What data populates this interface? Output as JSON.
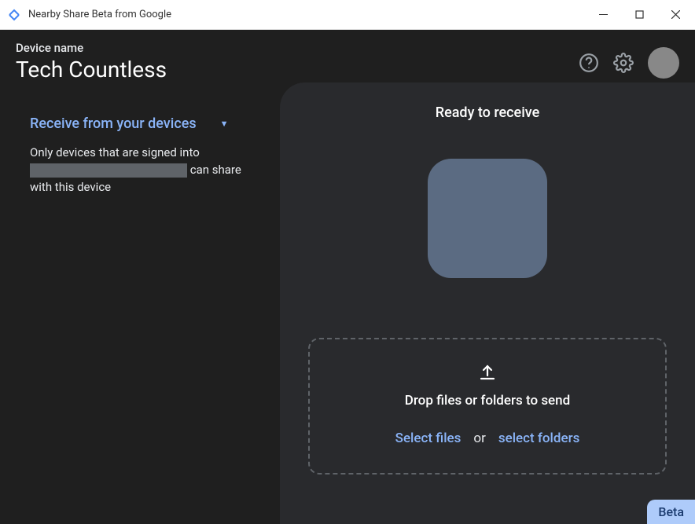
{
  "window": {
    "title": "Nearby Share Beta from Google"
  },
  "header": {
    "device_label": "Device name",
    "device_name": "Tech Countless"
  },
  "sidebar": {
    "receive_label": "Receive from your devices",
    "desc_prefix": "Only devices that are signed into ",
    "desc_suffix": " can share with this device"
  },
  "main": {
    "ready_title": "Ready to receive",
    "drop_text": "Drop files or folders to send",
    "select_files": "Select files",
    "or": "or",
    "select_folders": "select folders"
  },
  "beta_label": "Beta"
}
